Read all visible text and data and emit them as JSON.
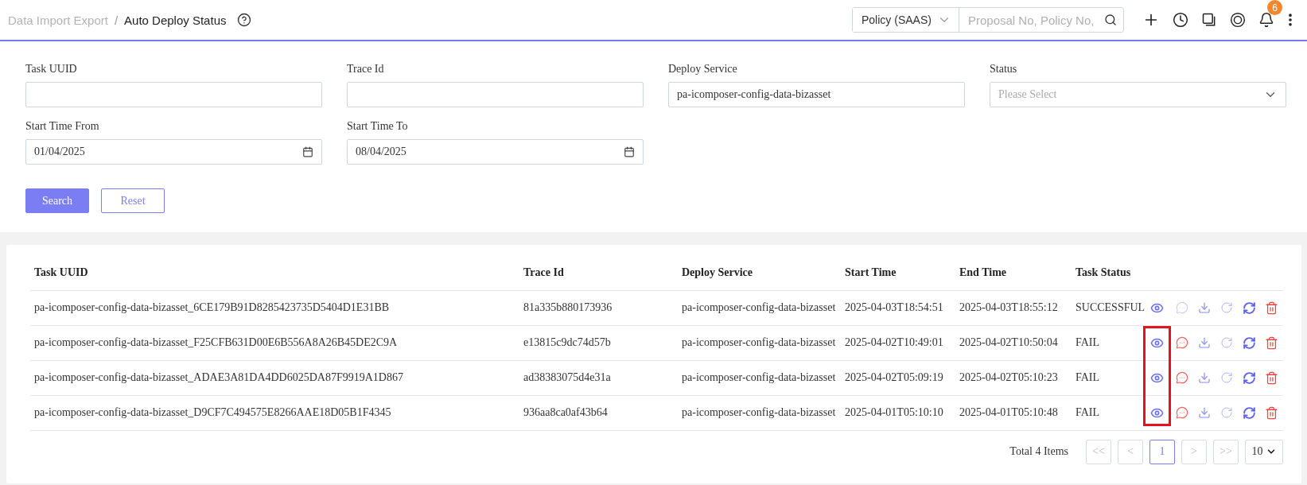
{
  "breadcrumb": {
    "separator": "/",
    "items": [
      {
        "label": "Data Import Export",
        "current": false
      },
      {
        "label": "Auto Deploy Status",
        "current": true
      }
    ]
  },
  "global_search": {
    "scope": "Policy (SAAS)",
    "placeholder": "Proposal No, Policy No,"
  },
  "notifications": {
    "badge": "6"
  },
  "filters": [
    {
      "label": "Task UUID",
      "kind": "text"
    },
    {
      "label": "Trace Id",
      "kind": "text"
    },
    {
      "label": "Deploy Service",
      "kind": "text",
      "value": "pa-icomposer-config-data-bizasset"
    },
    {
      "label": "Status",
      "kind": "select",
      "placeholder": "Please Select"
    },
    {
      "label": "Start Time From",
      "kind": "date",
      "value": "01/04/2025"
    },
    {
      "label": "Start Time To",
      "kind": "date",
      "value": "08/04/2025"
    }
  ],
  "buttons": [
    {
      "label": "Search",
      "kind": "primary"
    },
    {
      "label": "Reset",
      "kind": "secondary"
    }
  ],
  "table": {
    "columns": [
      "Task UUID",
      "Trace Id",
      "Deploy Service",
      "Start Time",
      "End Time",
      "Task Status"
    ],
    "rows": [
      {
        "cells": [
          "pa-icomposer-config-data-bizasset_6CE179B91D8285423735D5404D1E31BB",
          "81a335b880173936",
          "pa-icomposer-config-data-bizasset",
          "2025-04-03T18:54:51",
          "2025-04-03T18:55:12",
          "SUCCESSFUL"
        ],
        "comment_enabled": false,
        "view_highlighted": false
      },
      {
        "cells": [
          "pa-icomposer-config-data-bizasset_F25CFB631D00E6B556A8A26B45DE2C9A",
          "e13815c9dc74d57b",
          "pa-icomposer-config-data-bizasset",
          "2025-04-02T10:49:01",
          "2025-04-02T10:50:04",
          "FAIL"
        ],
        "comment_enabled": true,
        "view_highlighted": true
      },
      {
        "cells": [
          "pa-icomposer-config-data-bizasset_ADAE3A81DA4DD6025DA87F9919A1D867",
          "ad38383075d4e31a",
          "pa-icomposer-config-data-bizasset",
          "2025-04-02T05:09:19",
          "2025-04-02T05:10:23",
          "FAIL"
        ],
        "comment_enabled": true,
        "view_highlighted": true
      },
      {
        "cells": [
          "pa-icomposer-config-data-bizasset_D9CF7C494575E8266AAE18D05B1F4345",
          "936aa8ca0af43b64",
          "pa-icomposer-config-data-bizasset",
          "2025-04-01T05:10:10",
          "2025-04-01T05:10:48",
          "FAIL"
        ],
        "comment_enabled": true,
        "view_highlighted": true
      }
    ]
  },
  "pagination": {
    "total": "Total 4 Items",
    "pages": [
      {
        "label": "<<",
        "selected": false
      },
      {
        "label": "<",
        "selected": false
      },
      {
        "label": "1",
        "selected": true
      },
      {
        "label": ">",
        "selected": false
      },
      {
        "label": ">>",
        "selected": false
      }
    ],
    "page_size": "10"
  }
}
